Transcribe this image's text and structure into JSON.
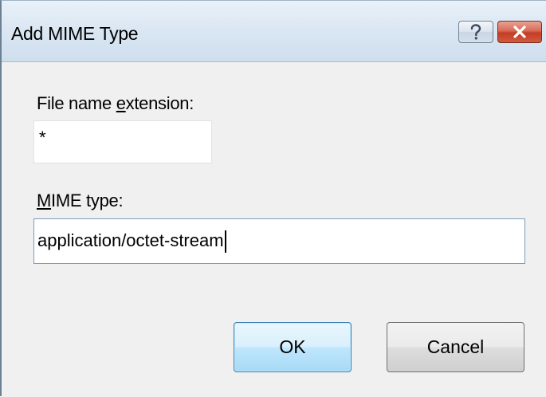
{
  "dialog": {
    "title": "Add MIME Type",
    "help_icon": "help-question-icon",
    "close_icon": "close-x-icon"
  },
  "extension": {
    "label_pre": "File name ",
    "label_key": "e",
    "label_post": "xtension:",
    "value": "*"
  },
  "mime_type": {
    "label_key": "M",
    "label_post": "IME type:",
    "value": "application/octet-stream"
  },
  "buttons": {
    "ok_label": "OK",
    "cancel_label": "Cancel"
  },
  "colors": {
    "close_button": "#c23d26",
    "ok_button_border": "#3c7fb1",
    "active_field_border": "#7c9ab9"
  }
}
